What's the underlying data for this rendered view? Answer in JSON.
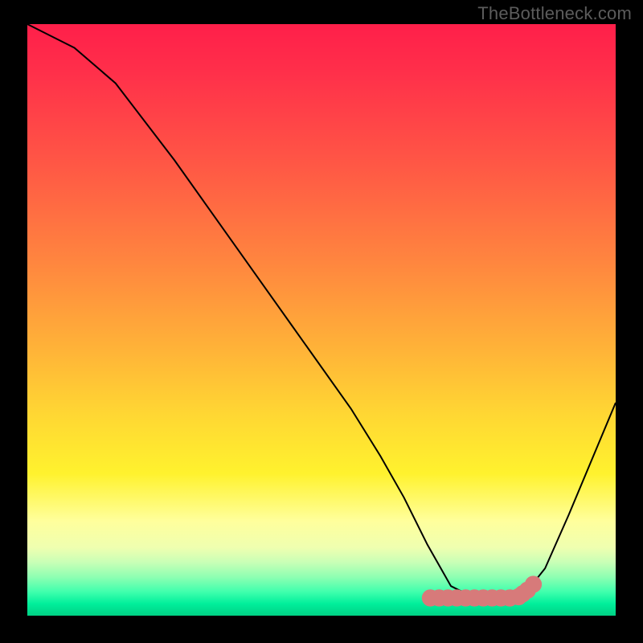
{
  "attribution": "TheBottleneck.com",
  "colors": {
    "curve_stroke": "#000000",
    "marker_fill": "#d77a7a",
    "frame_bg": "#000000"
  },
  "chart_data": {
    "type": "line",
    "title": "",
    "xlabel": "",
    "ylabel": "",
    "xlim": [
      0,
      100
    ],
    "ylim": [
      0,
      100
    ],
    "grid": false,
    "legend": false,
    "series": [
      {
        "name": "bottleneck-curve",
        "x": [
          0,
          4,
          8,
          15,
          25,
          35,
          45,
          55,
          60,
          64,
          68,
          72,
          76,
          80,
          84,
          88,
          92,
          100
        ],
        "y": [
          100,
          98,
          96,
          90,
          77,
          63,
          49,
          35,
          27,
          20,
          12,
          5,
          3,
          3,
          3,
          8,
          17,
          36
        ]
      }
    ],
    "markers": {
      "name": "optimal-range",
      "x": [
        68.5,
        70.0,
        71.5,
        73.0,
        74.5,
        76.0,
        77.5,
        79.0,
        80.5,
        82.0,
        83.5,
        84.2,
        85.0,
        86.0
      ],
      "y": [
        3.0,
        3.0,
        3.0,
        3.0,
        3.0,
        3.0,
        3.0,
        3.0,
        3.0,
        3.0,
        3.2,
        3.7,
        4.3,
        5.3
      ]
    }
  }
}
